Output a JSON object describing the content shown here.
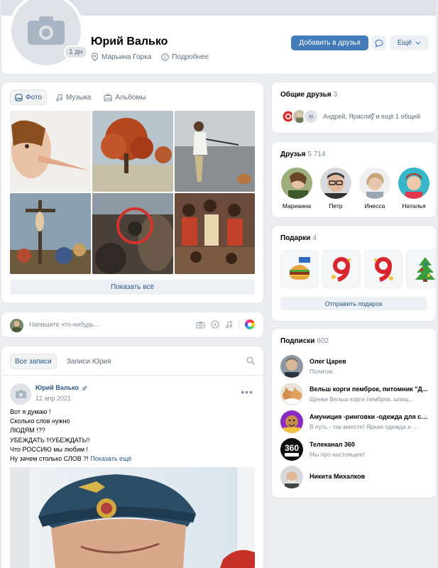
{
  "profile": {
    "name": "Юрий Валько",
    "avatar_badge": "1 дн",
    "location": "Марьина Горка",
    "details_label": "Подробнее",
    "add_friend_label": "Добавить в друзья",
    "more_label": "Ещё"
  },
  "photos": {
    "tabs": [
      {
        "label": "Фото",
        "icon": "image-icon",
        "active": true
      },
      {
        "label": "Музыка",
        "icon": "music-note-icon",
        "active": false
      },
      {
        "label": "Альбомы",
        "icon": "album-icon",
        "active": false
      }
    ],
    "show_all_label": "Показать всё"
  },
  "composer": {
    "placeholder": "Напишите что-нибудь..."
  },
  "wall": {
    "tabs": [
      {
        "label": "Все записи",
        "active": true
      },
      {
        "label": "Записи Юрия",
        "active": false
      }
    ],
    "post": {
      "author": "Юрий Валько",
      "date": "12 апр 2021",
      "lines": [
        "Вот я думаю !",
        "Сколько слов нужно",
        "ЛЮДЯМ !??",
        "УБЕЖДАТЬ !!!УБЕЖДАТЬ!!",
        "Что РОССИЮ мы любим !",
        "Ну зачем столько СЛОВ ?!"
      ],
      "show_more_label": "Показать ещё"
    }
  },
  "mutual_friends": {
    "title": "Общие друзья",
    "count": "3",
    "summary": "Андрей, Ярасла͡ў и ещё 1 общий"
  },
  "friends": {
    "title": "Друзья",
    "count": "5 714",
    "items": [
      {
        "name": "Марианна"
      },
      {
        "name": "Петр"
      },
      {
        "name": "Инесса"
      },
      {
        "name": "Наталья"
      }
    ]
  },
  "gifts": {
    "title": "Подарки",
    "count": "4",
    "send_label": "Отправить подарок"
  },
  "subscriptions": {
    "title": "Подписки",
    "count": "602",
    "items": [
      {
        "name": "Олег Царев",
        "desc": "Политик"
      },
      {
        "name": "Вельш корги пемброк, питомник \"Д...",
        "desc": "Щенки Вельш корги пемброк, шпиц..."
      },
      {
        "name": "Амуниция -ринговки -одежда для со...",
        "desc": "В путь - так вместе! Яркая одежда и ..."
      },
      {
        "name": "Телеканал 360",
        "desc": "Мы про настоящее!"
      },
      {
        "name": "Никита Михалков",
        "desc": ""
      }
    ]
  },
  "colors": {
    "accent": "#447bba",
    "link": "#2a5885",
    "background": "#ebedf0"
  }
}
